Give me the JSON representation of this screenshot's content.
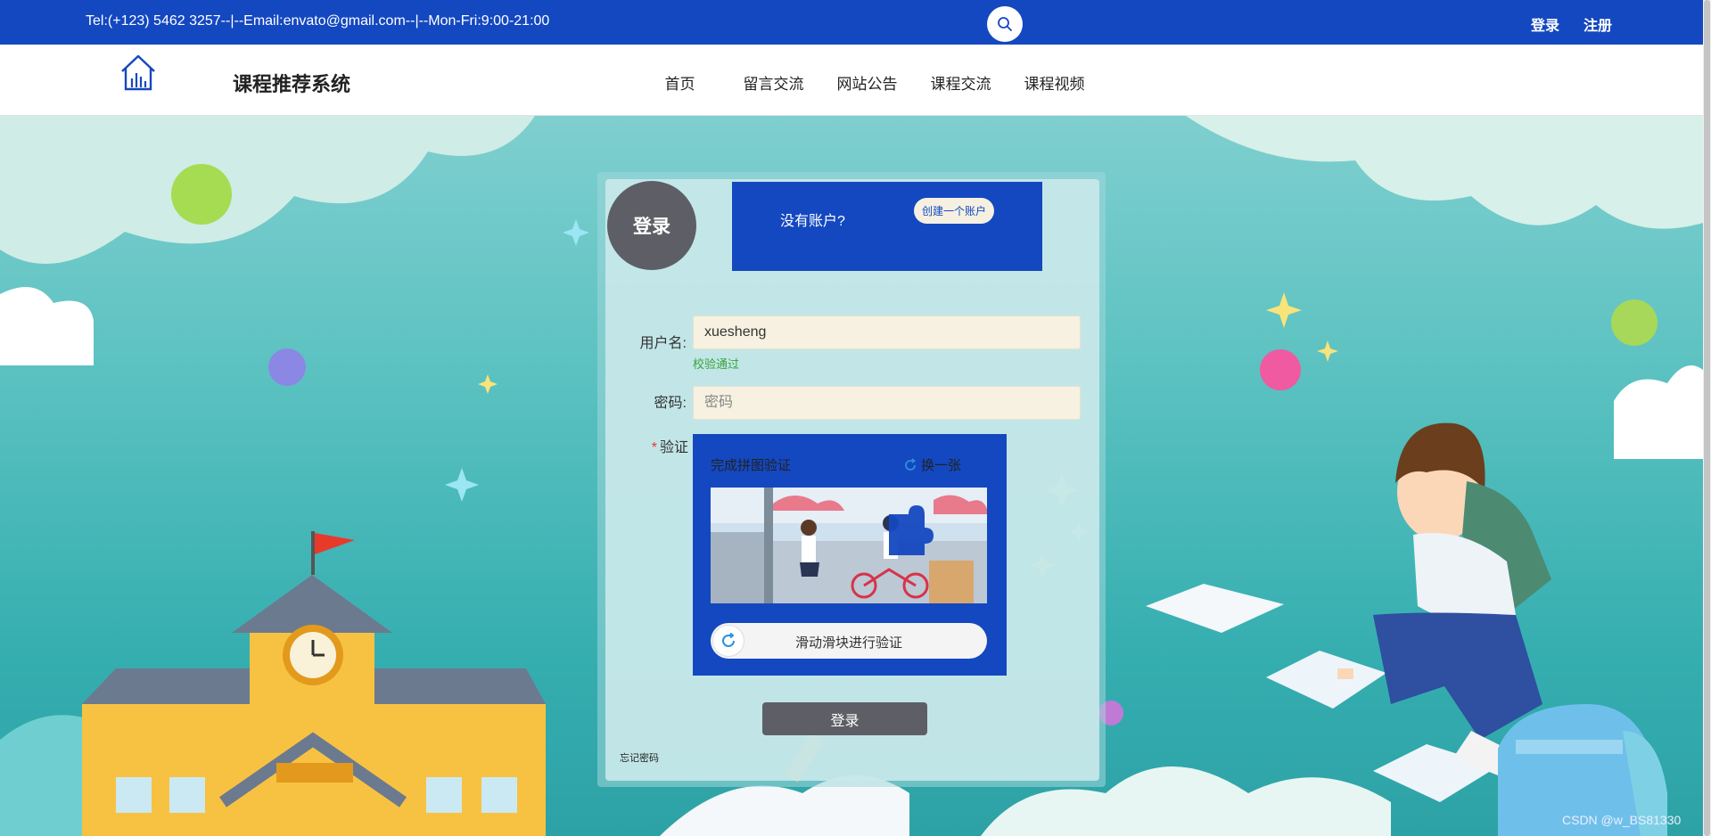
{
  "topbar": {
    "contact": "Tel:(+123) 5462 3257--|--Email:envato@gmail.com--|--Mon-Fri:9:00-21:00",
    "login": "登录",
    "register": "注册"
  },
  "navbar": {
    "site_title": "课程推荐系统",
    "items": [
      "首页",
      "留言交流",
      "网站公告",
      "课程交流",
      "课程视频"
    ]
  },
  "login_form": {
    "badge": "登录",
    "no_account": "没有账户?",
    "create_account": "创建一个账户",
    "username_label": "用户名:",
    "username_value": "xuesheng",
    "username_validation": "校验通过",
    "password_label": "密码:",
    "password_placeholder": "密码",
    "verify_required": "*",
    "verify_label": "验证",
    "captcha": {
      "title": "完成拼图验证",
      "refresh": "换一张",
      "slider_text": "滑动滑块进行验证"
    },
    "submit": "登录",
    "forgot_password": "忘记密码"
  },
  "watermark": "CSDN @w_BS81330",
  "colors": {
    "primary_blue": "#1448c0",
    "badge_gray": "#5e5f66",
    "input_bg": "#f6f1e1",
    "success_green": "#3aa33a"
  }
}
